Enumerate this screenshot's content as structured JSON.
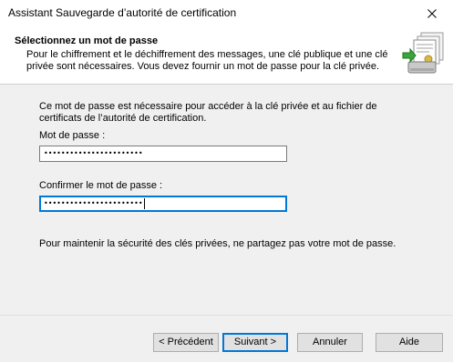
{
  "window": {
    "title": "Assistant Sauvegarde d’autorité de certification"
  },
  "header": {
    "title": "Sélectionnez un mot de passe",
    "subtitle": "Pour le chiffrement et le déchiffrement des messages, une clé publique et une clé privée sont nécessaires. Vous devez fournir un mot de passe pour la clé privée."
  },
  "body": {
    "description": "Ce mot de passe est nécessaire pour accéder à la clé privée et au fichier de certificats de l’autorité de certification.",
    "password_label": "Mot de passe :",
    "password_value": "•••••••••••••••••••••••",
    "confirm_label": "Confirmer le mot de passe :",
    "confirm_value": "•••••••••••••••••••••••",
    "note": "Pour maintenir la sécurité des clés privées, ne partagez pas votre mot de passe."
  },
  "buttons": {
    "previous": "< Précédent",
    "next": "Suivant >",
    "cancel": "Annuler",
    "help": "Aide"
  },
  "colors": {
    "focus_border": "#0078d7",
    "button_face": "#e1e1e1",
    "dialog_background": "#f0f0f0"
  },
  "icons": {
    "close": "close-icon",
    "header": "certificate-backup-icon"
  }
}
